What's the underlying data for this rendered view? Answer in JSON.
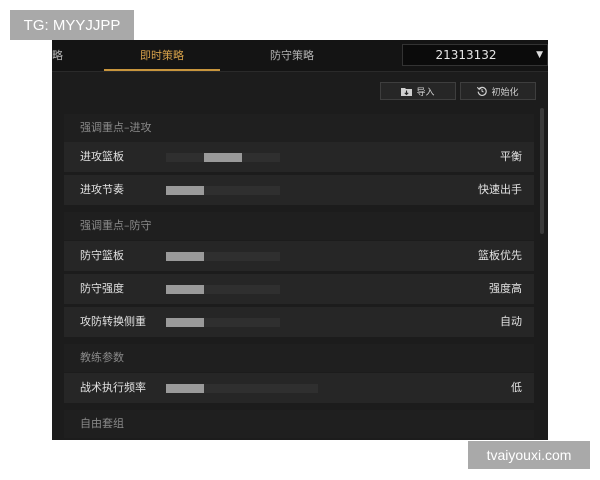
{
  "watermarks": {
    "tg": "TG: MYYJJPP",
    "site": "tvaiyouxi.com"
  },
  "tabs": {
    "partial": "略",
    "active": "即时策略",
    "defense": "防守策略"
  },
  "player_select": {
    "value": "21313132",
    "caret": "▼"
  },
  "toolbar": {
    "import_label": "导入",
    "init_label": "初始化"
  },
  "sections": {
    "offense": {
      "header": "强调重点–进攻",
      "rows": [
        {
          "label": "进攻篮板",
          "value": "平衡",
          "level": 0.5
        },
        {
          "label": "进攻节奏",
          "value": "快速出手",
          "level": 0.0
        }
      ]
    },
    "defense": {
      "header": "强调重点–防守",
      "rows": [
        {
          "label": "防守篮板",
          "value": "篮板优先",
          "level": 0.0
        },
        {
          "label": "防守强度",
          "value": "强度高",
          "level": 0.0
        },
        {
          "label": "攻防转换侧重",
          "value": "自动",
          "level": 0.0
        }
      ]
    },
    "coaching": {
      "header": "教练参数",
      "rows": [
        {
          "label": "战术执行频率",
          "value": "低",
          "level": 0.0
        }
      ]
    },
    "free": {
      "header": "自由套组"
    }
  },
  "colors": {
    "accent": "#c8953d",
    "panel_bg": "#1c1c1c",
    "row_bg": "#262626"
  },
  "icons": {
    "import": "import-folder-icon",
    "init": "reset-circle-icon",
    "dropdown": "chevron-down-icon"
  }
}
